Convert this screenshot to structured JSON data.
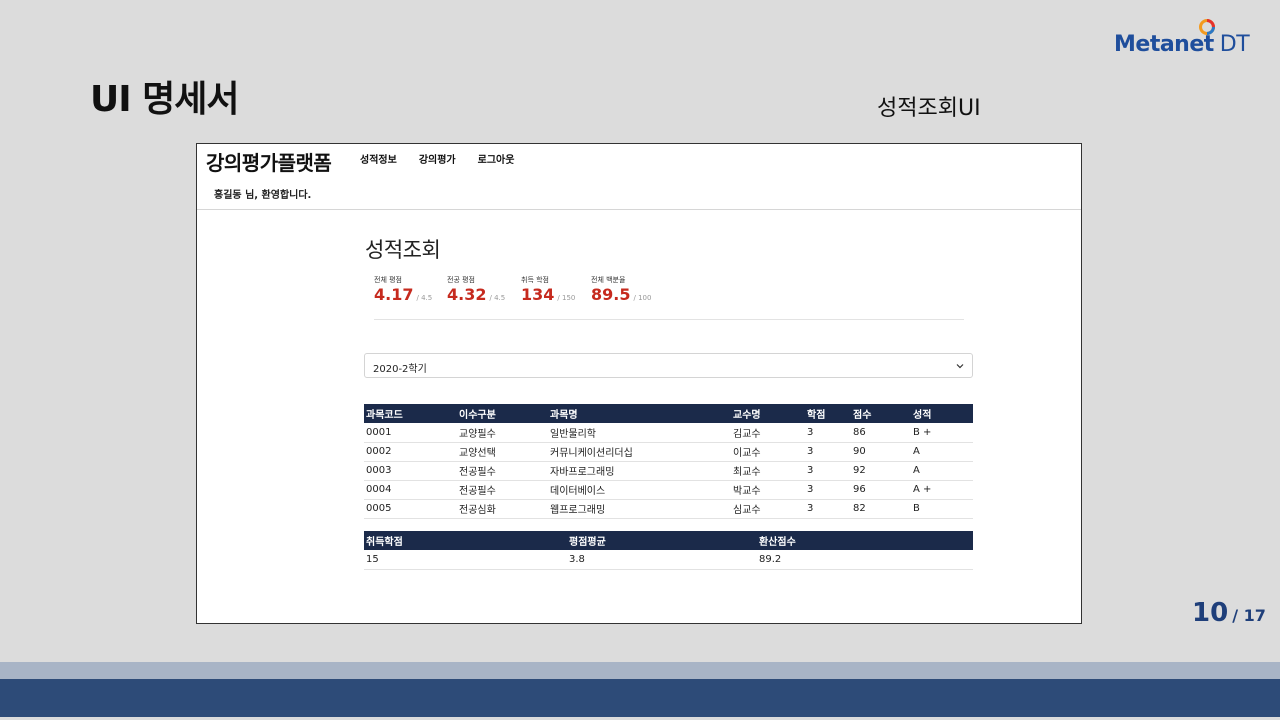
{
  "slide": {
    "title": "UI 명세서",
    "subtitle": "성적조회UI",
    "logo": {
      "brand": "Metanet",
      "suffix": "DT"
    },
    "page": {
      "current": "10",
      "total": "/ 17"
    }
  },
  "app": {
    "brand": "강의평가플랫폼",
    "menu": [
      "성적정보",
      "강의평가",
      "로그아웃"
    ],
    "welcome": "홍길동 님, 환영합니다.",
    "heading": "성적조회",
    "stats": [
      {
        "label": "전체 평점",
        "value": "4.17",
        "max": "/ 4.5"
      },
      {
        "label": "전공 평점",
        "value": "4.32",
        "max": "/ 4.5"
      },
      {
        "label": "취득 학점",
        "value": "134",
        "max": "/ 150"
      },
      {
        "label": "전체 백분율",
        "value": "89.5",
        "max": "/ 100"
      }
    ],
    "semester_select": {
      "value": "2020-2학기",
      "icon": "chevron-down-icon"
    },
    "courses": {
      "columns": [
        "과목코드",
        "이수구분",
        "과목명",
        "교수명",
        "학점",
        "점수",
        "성적"
      ],
      "rows": [
        [
          "0001",
          "교양필수",
          "일반물리학",
          "김교수",
          "3",
          "86",
          "B +"
        ],
        [
          "0002",
          "교양선택",
          "커뮤니케이션리더십",
          "이교수",
          "3",
          "90",
          "A"
        ],
        [
          "0003",
          "전공필수",
          "자바프로그래밍",
          "최교수",
          "3",
          "92",
          "A"
        ],
        [
          "0004",
          "전공필수",
          "데이터베이스",
          "박교수",
          "3",
          "96",
          "A +"
        ],
        [
          "0005",
          "전공심화",
          "웹프로그래밍",
          "심교수",
          "3",
          "82",
          "B"
        ]
      ]
    },
    "summary": {
      "columns": [
        "취득학점",
        "평점평균",
        "환산점수"
      ],
      "rows": [
        [
          "15",
          "3.8",
          "89.2"
        ]
      ]
    }
  },
  "colors": {
    "accent_red": "#c62a1e",
    "table_header": "#1b2a4a",
    "band_dark": "#2d4b78",
    "band_light": "#a8b4c6",
    "logo_blue": "#1f4e9c"
  }
}
